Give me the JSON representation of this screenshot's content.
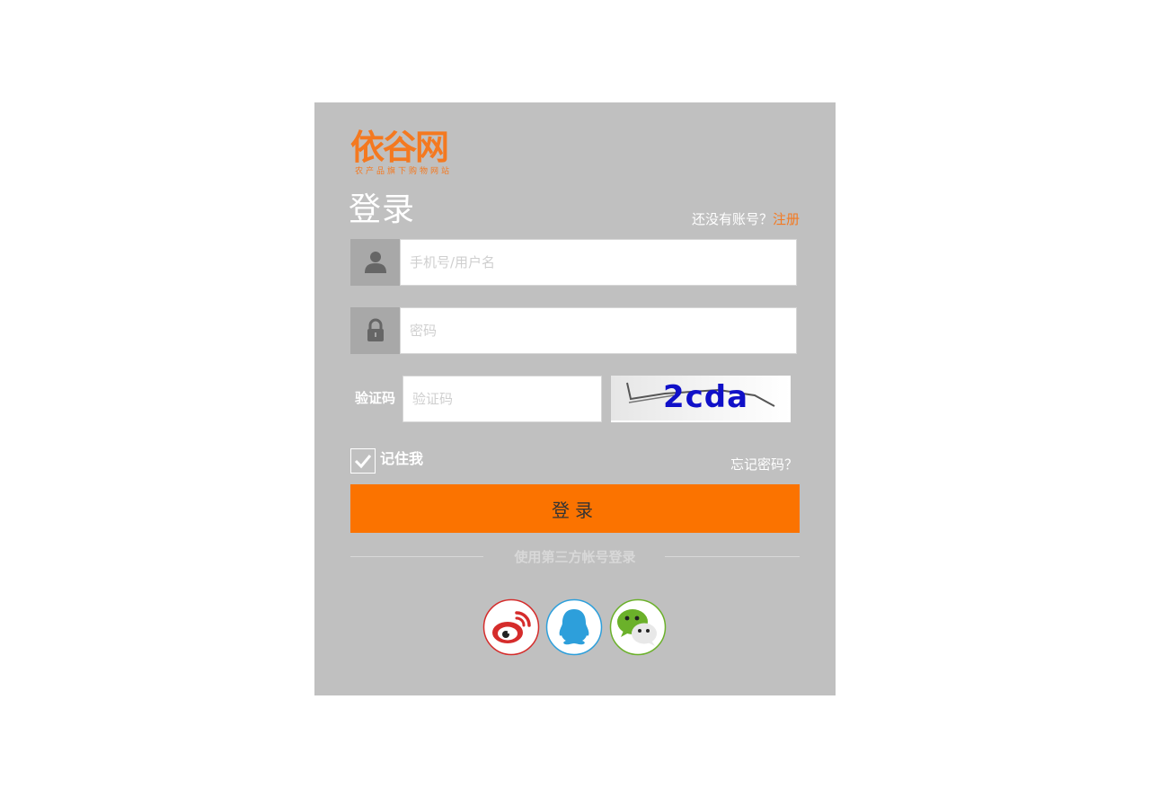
{
  "brand": {
    "logo_text": "依谷网",
    "logo_subtitle": "农产品旗下购物网站",
    "color": "#f47920"
  },
  "login": {
    "title": "登录",
    "register_prompt": "还没有账号？",
    "register_link": "注册",
    "username_placeholder": "手机号/用户名",
    "password_placeholder": "密码",
    "captcha_label": "验证码",
    "captcha_placeholder": "验证码",
    "captcha_code": "2cda",
    "remember_label": "记住我",
    "remember_checked": true,
    "forgot_link": "忘记密码？",
    "submit_label": "登录",
    "submit_color": "#fb7300"
  },
  "third_party": {
    "divider_text": "使用第三方帐号登录",
    "providers": [
      {
        "name": "weibo",
        "icon": "weibo-icon",
        "color": "#d52c2b"
      },
      {
        "name": "qq",
        "icon": "qq-icon",
        "color": "#2d9fdb"
      },
      {
        "name": "wechat",
        "icon": "wechat-icon",
        "color": "#6bb12a"
      }
    ]
  },
  "icons": {
    "username": "user-icon",
    "password": "lock-icon"
  }
}
